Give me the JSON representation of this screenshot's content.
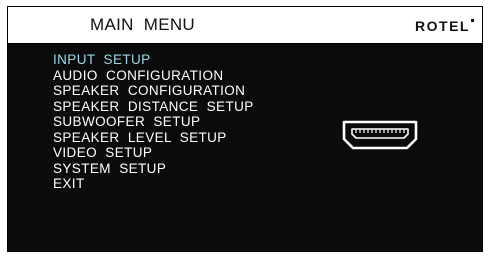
{
  "header": {
    "title": "MAIN  MENU",
    "brand": "ROTEL"
  },
  "menu": {
    "items": [
      {
        "label": "INPUT  SETUP",
        "selected": true
      },
      {
        "label": "AUDIO  CONFIGURATION",
        "selected": false
      },
      {
        "label": "SPEAKER  CONFIGURATION",
        "selected": false
      },
      {
        "label": "SPEAKER  DISTANCE  SETUP",
        "selected": false
      },
      {
        "label": "SUBWOOFER  SETUP",
        "selected": false
      },
      {
        "label": "SPEAKER  LEVEL  SETUP",
        "selected": false
      },
      {
        "label": "VIDEO  SETUP",
        "selected": false
      },
      {
        "label": "SYSTEM  SETUP",
        "selected": false
      },
      {
        "label": "EXIT",
        "selected": false
      }
    ]
  },
  "icons": {
    "connector": "hdmi-connector-icon"
  },
  "colors": {
    "screen_background": "#0b0b0b",
    "header_background": "#ffffff",
    "menu_text": "#ffffff",
    "selected_text": "#9ed8e6"
  }
}
